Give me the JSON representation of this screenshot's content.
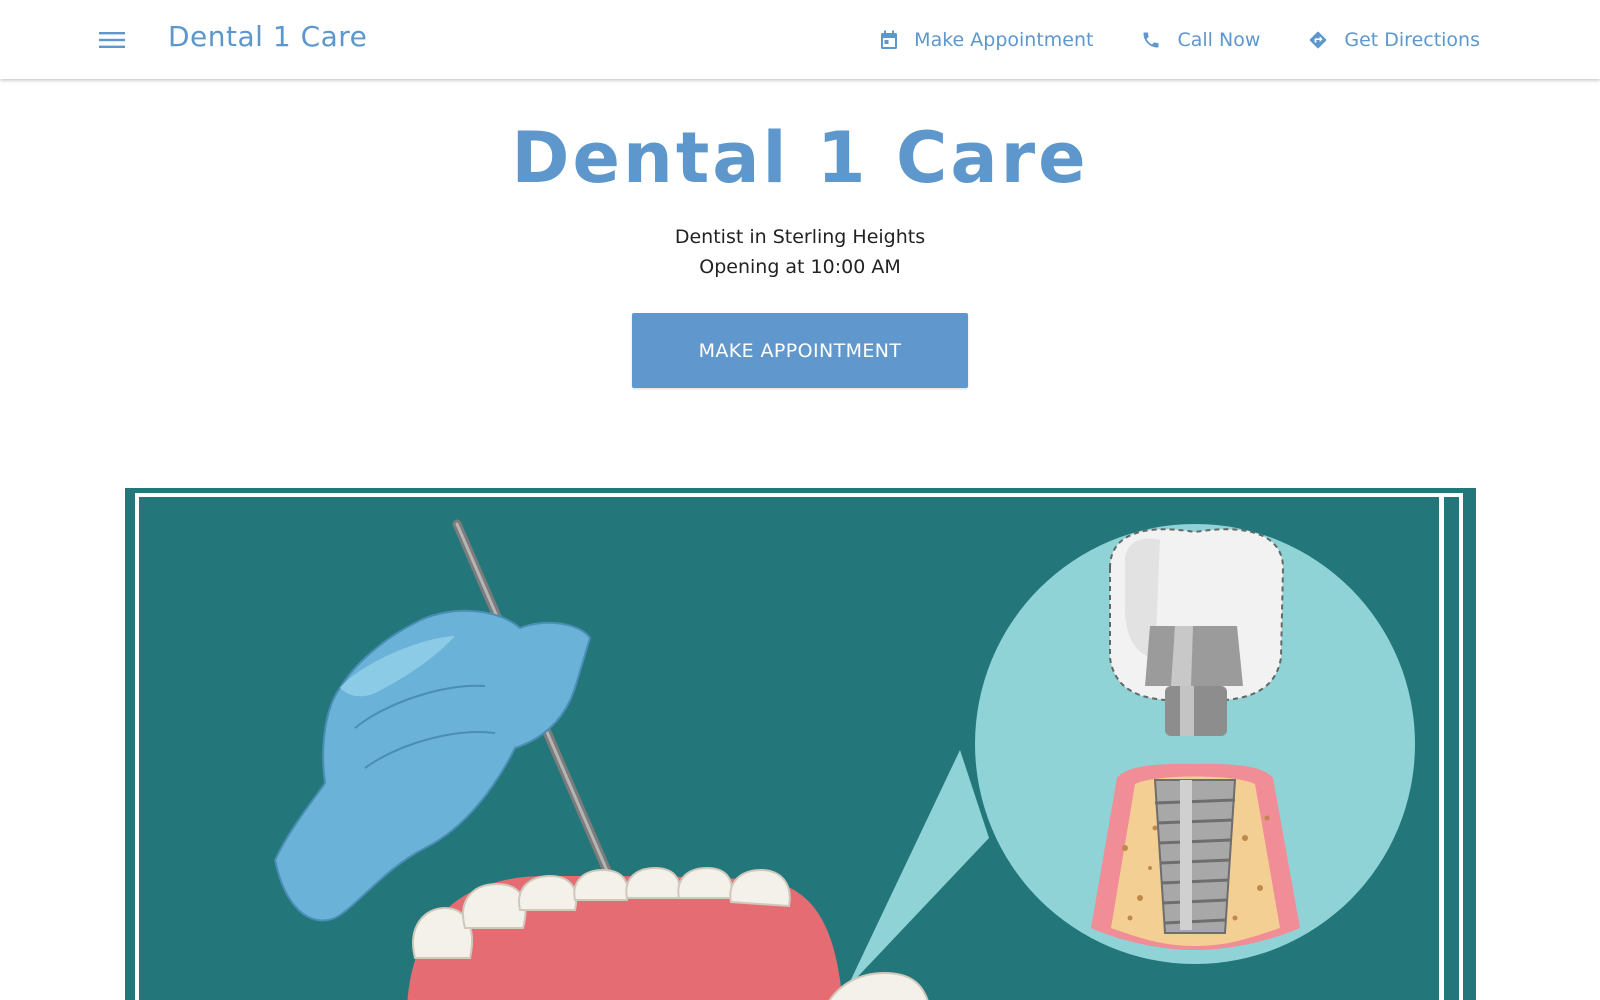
{
  "header": {
    "brand": "Dental 1 Care",
    "menu_icon": "menu-icon",
    "nav": [
      {
        "label": "Make Appointment",
        "icon": "calendar-icon"
      },
      {
        "label": "Call Now",
        "icon": "phone-icon"
      },
      {
        "label": "Get Directions",
        "icon": "directions-icon"
      }
    ]
  },
  "hero": {
    "title": "Dental 1 Care",
    "subtitle": "Dentist in Sterling Heights",
    "hours": "Opening at 10:00 AM",
    "cta_label": "MAKE APPOINTMENT"
  },
  "colors": {
    "accent": "#5e97cc",
    "button": "#6098cd",
    "illustration_bg": "#23777a"
  }
}
